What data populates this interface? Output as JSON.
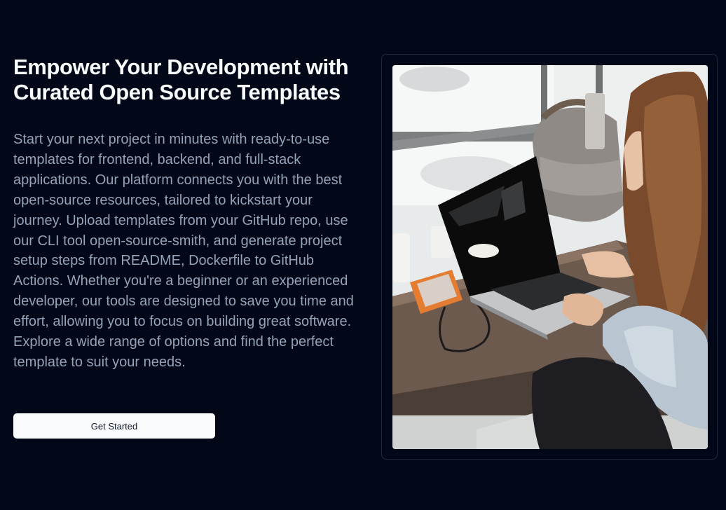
{
  "hero": {
    "title": "Empower Your Development with Curated Open Source Templates",
    "description": "Start your next project in minutes with ready-to-use templates for frontend, backend, and full-stack applications. Our platform connects you with the best open-source resources, tailored to kickstart your journey. Upload templates from your GitHub repo, use our CLI tool open-source-smith, and generate project setup steps from README, Dockerfile to GitHub Actions. Whether you're a beginner or an experienced developer, our tools are designed to save you time and effort, allowing you to focus on building great software. Explore a wide range of options and find the perfect template to suit your needs.",
    "cta_label": "Get Started"
  },
  "colors": {
    "background": "#020817",
    "heading": "#f8fafc",
    "body_text": "#94a3b8",
    "button_bg": "#f8fafc",
    "button_text": "#0f172a",
    "card_border": "#1e293b"
  }
}
